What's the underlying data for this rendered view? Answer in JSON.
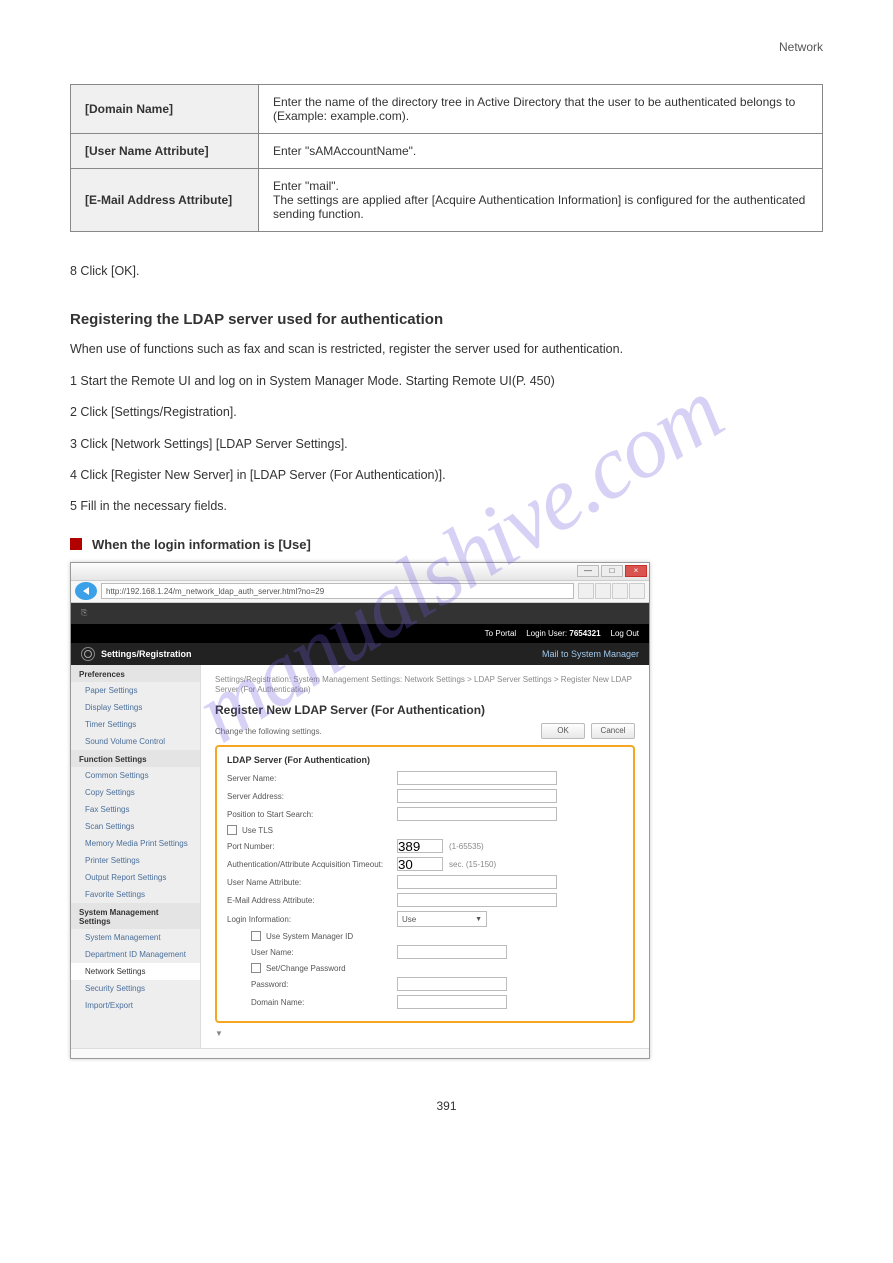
{
  "header": {
    "left": "",
    "right": "Network"
  },
  "spec_table": {
    "rows": [
      {
        "label": "[Domain Name]",
        "value": "Enter the name of the directory tree in Active Directory that the user to be authenticated belongs to (Example: example.com)."
      },
      {
        "label": "[User Name Attribute]",
        "value": "Enter \"sAMAccountName\"."
      },
      {
        "label": "[E-Mail Address Attribute]",
        "value": "Enter \"mail\".\nThe settings are applied after [Acquire Authentication Information] is configured for the authenticated sending function."
      }
    ]
  },
  "body": {
    "p1": "8    Click [OK].",
    "heading": "Registering the LDAP server used for authentication",
    "p2": "When use of functions such as fax and scan is restricted, register the server used for authentication.",
    "steps": [
      "1    Start the Remote UI and log on in System Manager Mode.  Starting Remote UI(P. 450)",
      "2    Click [Settings/Registration].",
      "3    Click [Network Settings]  [LDAP Server Settings].",
      "4    Click [Register New Server] in [LDAP Server (For Authentication)].",
      "5    Fill in the necessary fields."
    ]
  },
  "flag": {
    "text": "When the login information is [Use]"
  },
  "ui": {
    "address": "http://192.168.1.24/m_network_ldap_auth_server.html?no=29",
    "topbar": {
      "portal": "To Portal",
      "login": "Login User:",
      "user": "7654321",
      "logout": "Log Out"
    },
    "sr": {
      "title": "Settings/Registration",
      "mail": "Mail to System Manager"
    },
    "sidebar": {
      "sections": [
        {
          "title": "Preferences",
          "items": [
            "Paper Settings",
            "Display Settings",
            "Timer Settings",
            "Sound Volume Control"
          ]
        },
        {
          "title": "Function Settings",
          "items": [
            "Common Settings",
            "Copy Settings",
            "Fax Settings",
            "Scan Settings",
            "Memory Media Print Settings",
            "Printer Settings",
            "Output Report Settings",
            "Favorite Settings"
          ]
        },
        {
          "title": "System Management Settings",
          "items": [
            "System Management",
            "Department ID Management",
            "Network Settings",
            "Security Settings",
            "Import/Export"
          ]
        }
      ],
      "active": "Network Settings"
    },
    "content": {
      "crumb": "Settings/Registration: System Management Settings: Network Settings > LDAP Server Settings > Register New LDAP Server (For Authentication)",
      "title": "Register New LDAP Server (For Authentication)",
      "hint": "Change the following settings.",
      "ok": "OK",
      "cancel": "Cancel",
      "box_title": "LDAP Server (For Authentication)",
      "fields": {
        "server_name": "Server Name:",
        "server_address": "Server Address:",
        "start_search": "Position to Start Search:",
        "use_tls": "Use TLS",
        "port": "Port Number:",
        "port_val": "389",
        "port_range": "(1-65535)",
        "timeout": "Authentication/Attribute Acquisition Timeout:",
        "timeout_val": "30",
        "timeout_unit": "sec. (15-150)",
        "user_attr": "User Name Attribute:",
        "mail_attr": "E-Mail Address Attribute:",
        "login_info": "Login Information:",
        "login_info_val": "Use",
        "use_sysmgr": "Use System Manager ID",
        "username": "User Name:",
        "setchange": "Set/Change Password",
        "password": "Password:",
        "domain": "Domain Name:"
      }
    }
  },
  "page_number": "391",
  "watermark": "manualshive.com"
}
